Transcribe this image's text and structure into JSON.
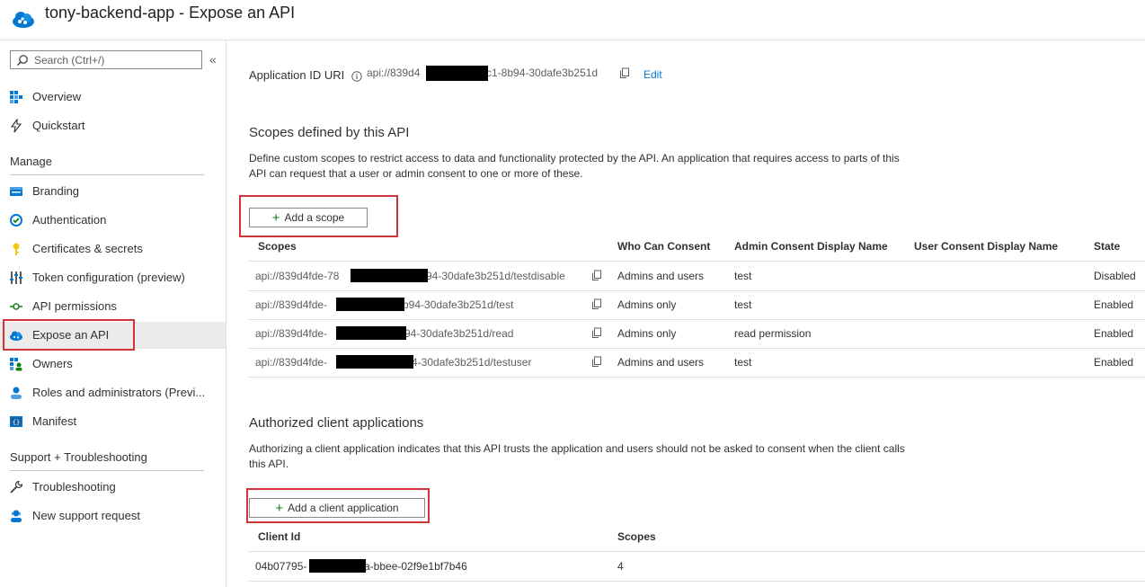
{
  "header": {
    "title": "tony-backend-app - Expose an API",
    "icon": "app-cloud-icon"
  },
  "sidebar": {
    "search_placeholder": "Search (Ctrl+/)",
    "collapse_glyph": "«",
    "top_items": [
      {
        "label": "Overview",
        "icon": "grid-overview-icon"
      },
      {
        "label": "Quickstart",
        "icon": "lightning-icon"
      }
    ],
    "manage_title": "Manage",
    "manage_items": [
      {
        "label": "Branding",
        "icon": "branding-icon"
      },
      {
        "label": "Authentication",
        "icon": "authentication-icon"
      },
      {
        "label": "Certificates & secrets",
        "icon": "key-icon"
      },
      {
        "label": "Token configuration (preview)",
        "icon": "token-config-icon"
      },
      {
        "label": "API permissions",
        "icon": "api-permissions-icon"
      },
      {
        "label": "Expose an API",
        "icon": "cloud-icon",
        "active": true
      },
      {
        "label": "Owners",
        "icon": "owners-icon"
      },
      {
        "label": "Roles and administrators (Previ...",
        "icon": "roles-icon"
      },
      {
        "label": "Manifest",
        "icon": "manifest-icon"
      }
    ],
    "support_title": "Support + Troubleshooting",
    "support_items": [
      {
        "label": "Troubleshooting",
        "icon": "wrench-icon"
      },
      {
        "label": "New support request",
        "icon": "support-person-icon"
      }
    ]
  },
  "main": {
    "app_id_uri": {
      "label": "Application ID URI",
      "value_start": "api://839d4",
      "value_end": "c1-8b94-30dafe3b251d",
      "edit_label": "Edit"
    },
    "scopes_section": {
      "title": "Scopes defined by this API",
      "description_line1": "Define custom scopes to restrict access to data and functionality protected by the API. An application that requires access to parts of this",
      "description_line2": "API can request that a user or admin consent to one or more of these.",
      "add_button": "Add a scope",
      "columns": [
        "Scopes",
        "Who Can Consent",
        "Admin Consent Display Name",
        "User Consent Display Name",
        "State"
      ],
      "rows": [
        {
          "scope_start": "api://839d4fde-78",
          "scope_end": "94-30dafe3b251d/testdisable",
          "who": "Admins and users",
          "admin_name": "test",
          "user_name": "",
          "state": "Disabled"
        },
        {
          "scope_start": "api://839d4fde-",
          "scope_end": "b94-30dafe3b251d/test",
          "who": "Admins only",
          "admin_name": "test",
          "user_name": "",
          "state": "Enabled"
        },
        {
          "scope_start": "api://839d4fde-",
          "scope_end": "94-30dafe3b251d/read",
          "who": "Admins only",
          "admin_name": "read permission",
          "user_name": "",
          "state": "Enabled"
        },
        {
          "scope_start": "api://839d4fde-",
          "scope_end": "4-30dafe3b251d/testuser",
          "who": "Admins and users",
          "admin_name": "test",
          "user_name": "",
          "state": "Enabled"
        }
      ]
    },
    "clients_section": {
      "title": "Authorized client applications",
      "description_line1": "Authorizing a client application indicates that this API trusts the application and users should not be asked to consent when the client calls",
      "description_line2": "this API.",
      "add_button": "Add a client application",
      "columns": [
        "Client Id",
        "Scopes"
      ],
      "rows": [
        {
          "client_start": "04b07795-",
          "client_end": "a-bbee-02f9e1bf7b46",
          "scopes": "4"
        }
      ]
    }
  },
  "colors": {
    "accent": "#0078d4",
    "highlight_box": "#d13438",
    "plus_green": "#107c10"
  }
}
